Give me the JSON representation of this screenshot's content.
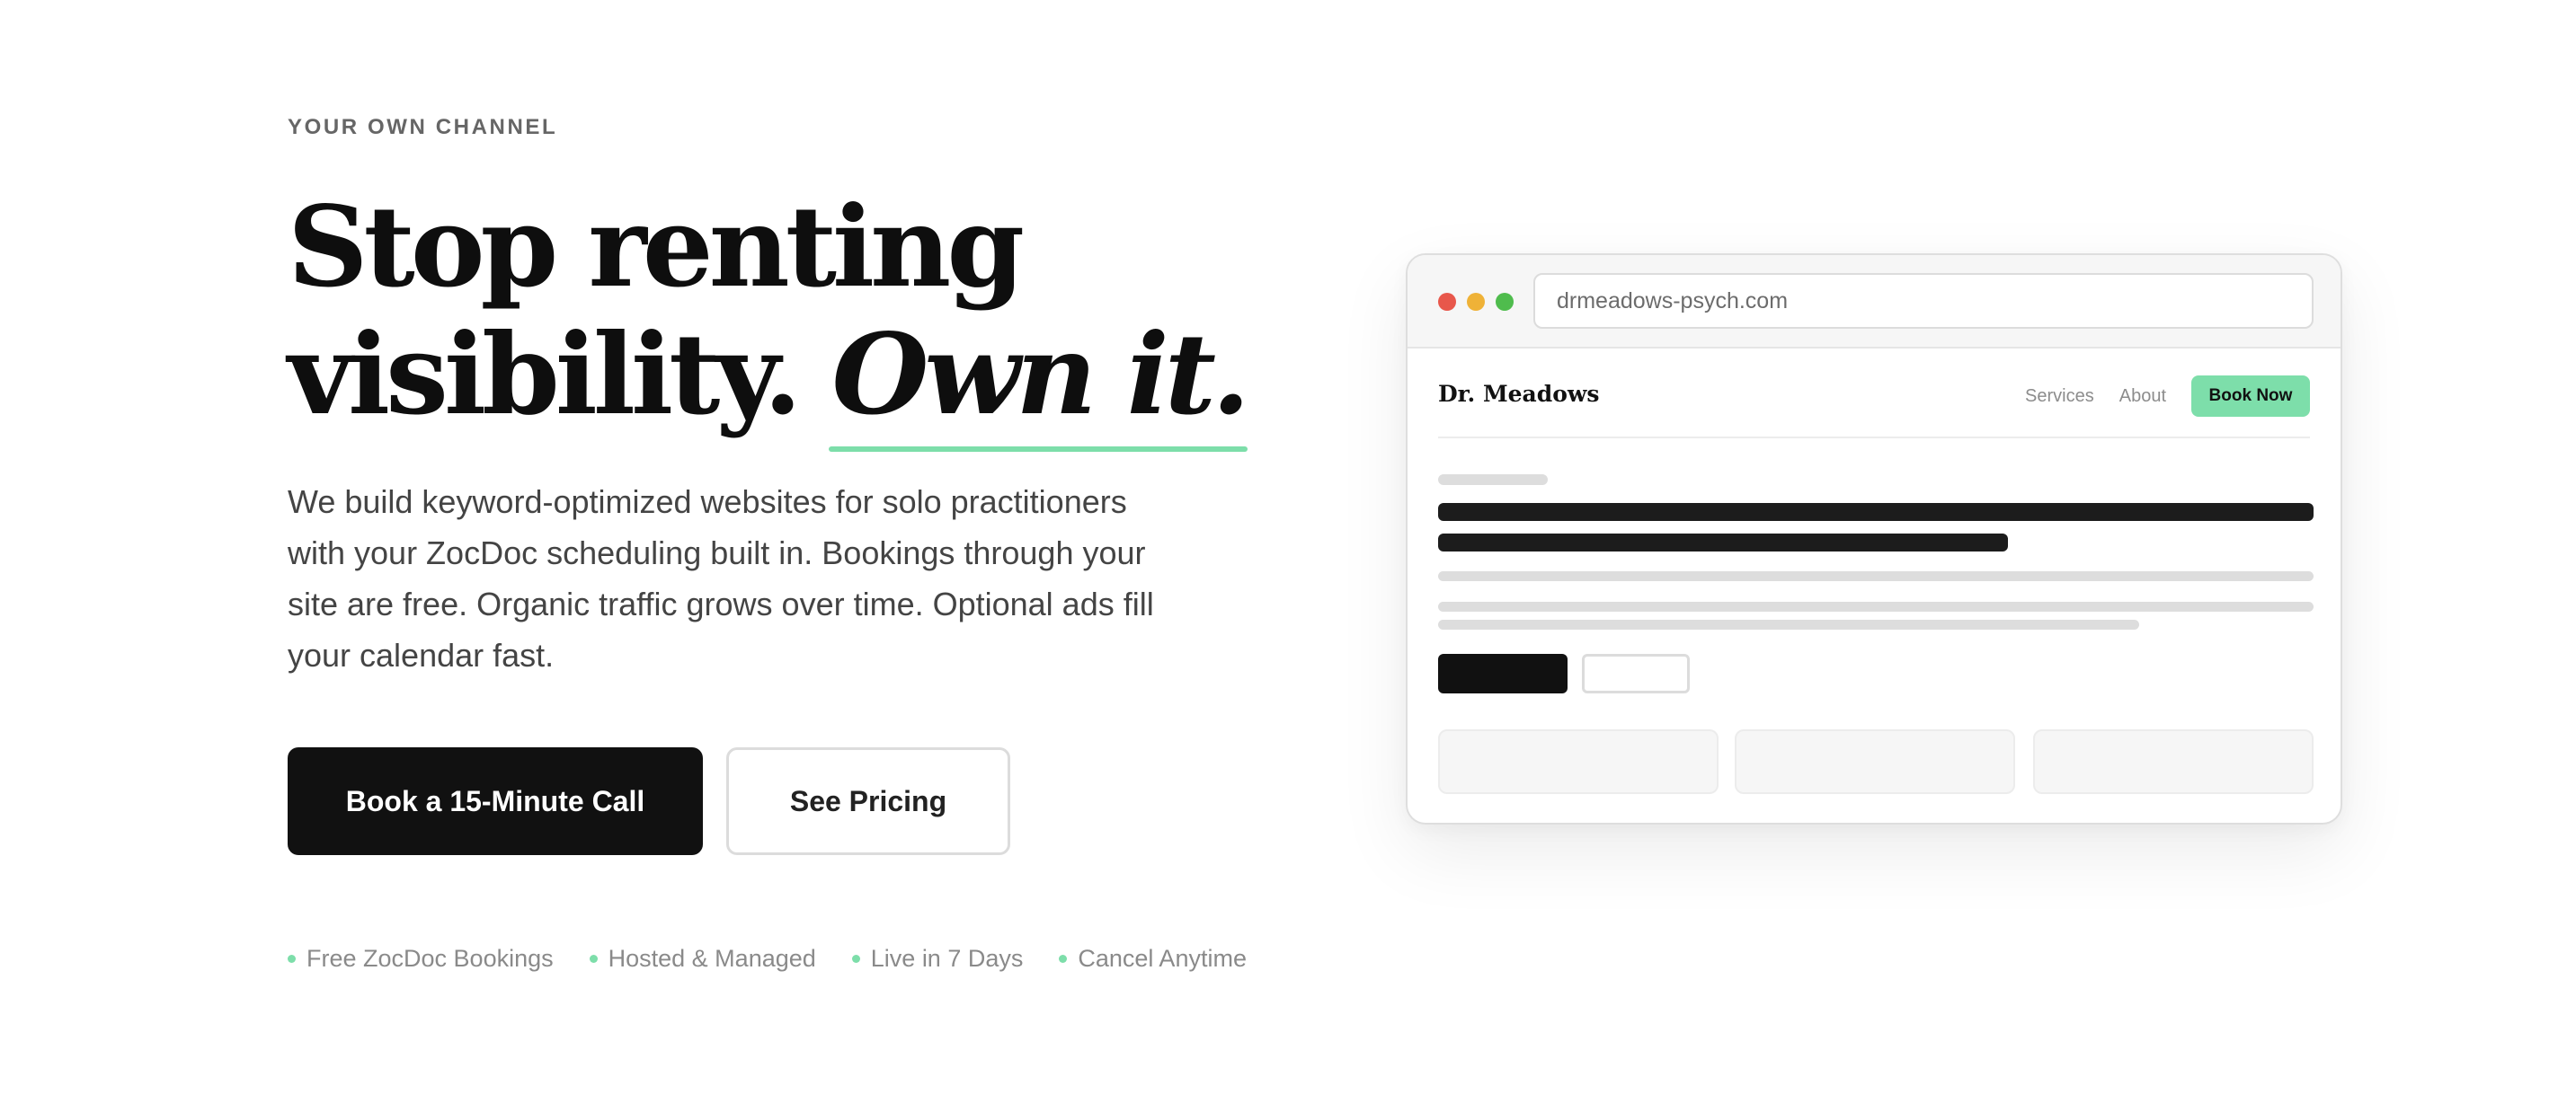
{
  "hero": {
    "eyebrow": "YOUR OWN CHANNEL",
    "headline_line1": "Stop renting",
    "headline_line2_plain": "visibility. ",
    "headline_line2_accent": "Own it.",
    "body": "We build keyword-optimized websites for solo practitioners with your ZocDoc scheduling built in. Bookings through your site are free. Organic traffic grows over time. Optional ads fill your calendar fast.",
    "primary_cta": "Book a 15-Minute Call",
    "secondary_cta": "See Pricing",
    "features": [
      "Free ZocDoc Bookings",
      "Hosted & Managed",
      "Live in 7 Days",
      "Cancel Anytime"
    ]
  },
  "mockup": {
    "url": "drmeadows-psych.com",
    "site_name": "Dr. Meadows",
    "nav_links": [
      "Services",
      "About"
    ],
    "nav_cta": "Book Now"
  },
  "colors": {
    "accent": "#7ddeaa",
    "primary_button": "#111111",
    "traffic_red": "#e8574b",
    "traffic_yellow": "#efb237",
    "traffic_green": "#4fbc4d"
  }
}
